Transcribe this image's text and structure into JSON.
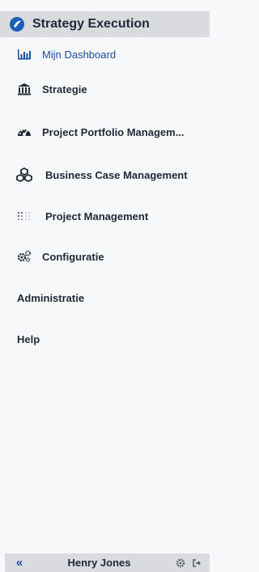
{
  "header": {
    "title": "Strategy Execution"
  },
  "nav": {
    "items": [
      {
        "label": "Mijn Dashboard",
        "icon": "bar-chart-icon"
      },
      {
        "label": "Strategie",
        "icon": "institution-icon"
      },
      {
        "label": "Project Portfolio Managem...",
        "icon": "dashboard-gauge-icon"
      },
      {
        "label": "Business Case Management",
        "icon": "cubes-icon"
      },
      {
        "label": "Project Management",
        "icon": "grid-dots-icon"
      },
      {
        "label": "Configuratie",
        "icon": "gears-icon"
      },
      {
        "label": "Administratie"
      },
      {
        "label": "Help"
      }
    ]
  },
  "footer": {
    "collapse_label": "«",
    "user_name": "Henry Jones",
    "settings_icon": "gear-icon",
    "logout_icon": "sign-out-icon"
  },
  "colors": {
    "accent": "#1a4f9c",
    "header_bg": "#d9dbde",
    "sidebar_bg": "#f7f8fa"
  }
}
